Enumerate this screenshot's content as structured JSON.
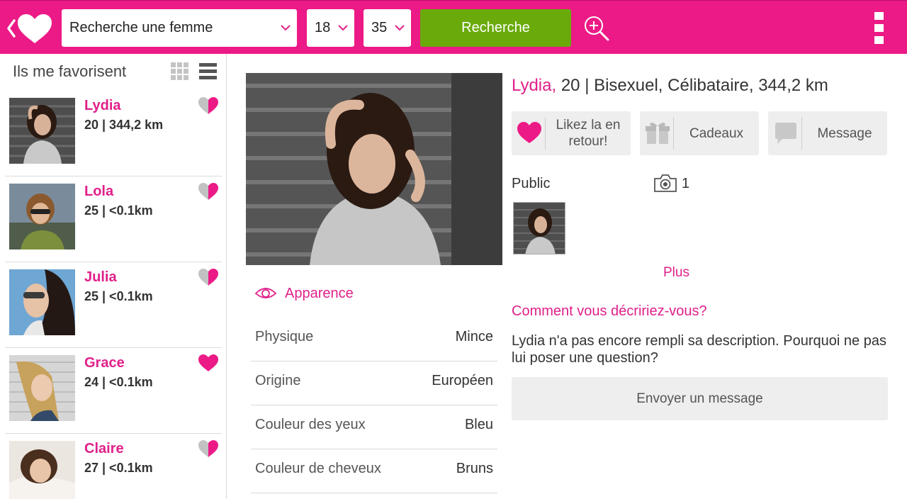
{
  "colors": {
    "brand": "#ec1a86",
    "accent_text": "#e0208a",
    "search_green": "#6aab0b"
  },
  "search": {
    "gender": "Recherche une femme",
    "age_min": "18",
    "age_max": "35",
    "button": "Recherche"
  },
  "favorites": {
    "title": "Ils me favorisent",
    "items": [
      {
        "name": "Lydia",
        "meta": "20 | 344,2 km",
        "liked": false
      },
      {
        "name": "Lola",
        "meta": "25 | <0.1km",
        "liked": false
      },
      {
        "name": "Julia",
        "meta": "25 | <0.1km",
        "liked": false
      },
      {
        "name": "Grace",
        "meta": "24 | <0.1km",
        "liked": true
      },
      {
        "name": "Claire",
        "meta": "27 | <0.1km",
        "liked": false
      }
    ]
  },
  "profile": {
    "name": "Lydia,",
    "details": " 20 | Bisexuel, Célibataire, 344,2 km",
    "actions": {
      "like": "Likez la en retour!",
      "gifts": "Cadeaux",
      "message": "Message"
    },
    "public_label": "Public",
    "photo_count": "1",
    "more": "Plus",
    "question": "Comment vous décririez-vous?",
    "description": "Lydia n'a pas encore rempli sa description. Pourquoi ne pas lui poser une question?",
    "send_message": "Envoyer un message"
  },
  "appearance": {
    "title": "Apparence",
    "rows": [
      {
        "key": "Physique",
        "value": "Mince"
      },
      {
        "key": "Origine",
        "value": "Européen"
      },
      {
        "key": "Couleur des yeux",
        "value": "Bleu"
      },
      {
        "key": "Couleur de cheveux",
        "value": "Bruns"
      }
    ]
  }
}
